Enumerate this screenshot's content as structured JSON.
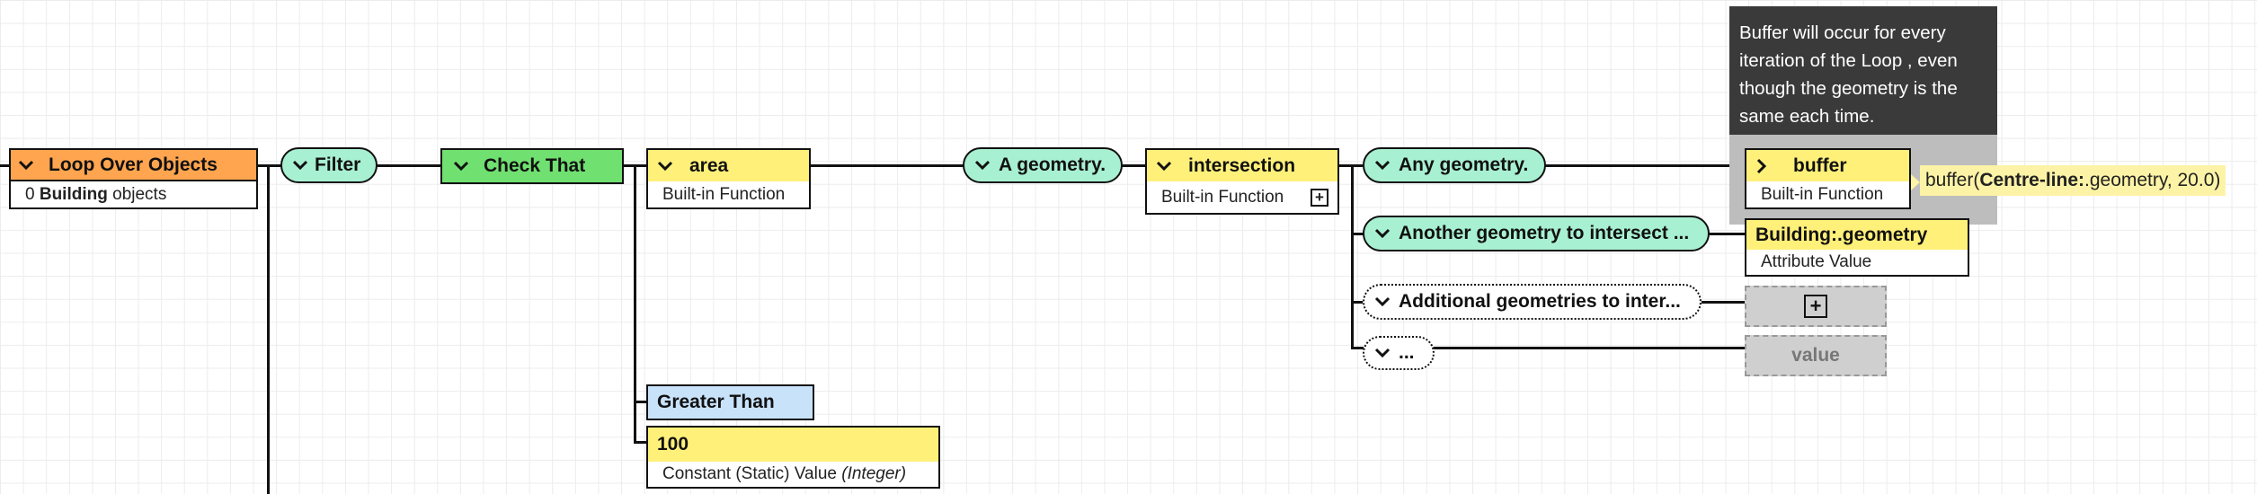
{
  "nodes": {
    "loop": {
      "title": "Loop Over Objects",
      "count": "0",
      "type_name": "Building",
      "suffix": "objects"
    },
    "filter": {
      "label": "Filter"
    },
    "check_that": {
      "label": "Check That"
    },
    "area": {
      "title": "area",
      "subtitle": "Built-in Function"
    },
    "a_geometry": {
      "label": "A geometry."
    },
    "intersection": {
      "title": "intersection",
      "subtitle": "Built-in Function",
      "expand_symbol": "⊞"
    },
    "any_geometry": {
      "label": "Any geometry."
    },
    "another_geometry": {
      "label": "Another geometry to intersect ..."
    },
    "additional_geometries": {
      "label": "Additional geometries to inter..."
    },
    "ellipsis_slot": {
      "label": "..."
    },
    "buffer": {
      "title": "buffer",
      "subtitle": "Built-in Function"
    },
    "building_geometry": {
      "title": "Building:.geometry",
      "subtitle": "Attribute Value"
    },
    "add_placeholder": {
      "symbol": "⊞"
    },
    "value_placeholder": {
      "label": "value"
    },
    "greater_than": {
      "label": "Greater Than"
    },
    "constant_100": {
      "title": "100",
      "subtitle": "Constant (Static) Value",
      "type": "(Integer)"
    }
  },
  "tooltip": {
    "lines": [
      "Buffer will occur for every",
      "iteration of the Loop , even",
      "though the geometry is the",
      "same each time."
    ]
  },
  "expression": {
    "func": "buffer(",
    "object": "Centre-line:",
    "rest": ".geometry, 20.0)"
  },
  "colors": {
    "loop": "#ffa54f",
    "function": "#fff07a",
    "check": "#70e070",
    "pill": "#a8f0d2",
    "comparison": "#c8e2fa",
    "tooltip": "#3a3a3a"
  },
  "icons": {
    "expanded": "chevron-down-icon",
    "collapsed": "chevron-right-icon",
    "add": "plus-square-icon"
  }
}
